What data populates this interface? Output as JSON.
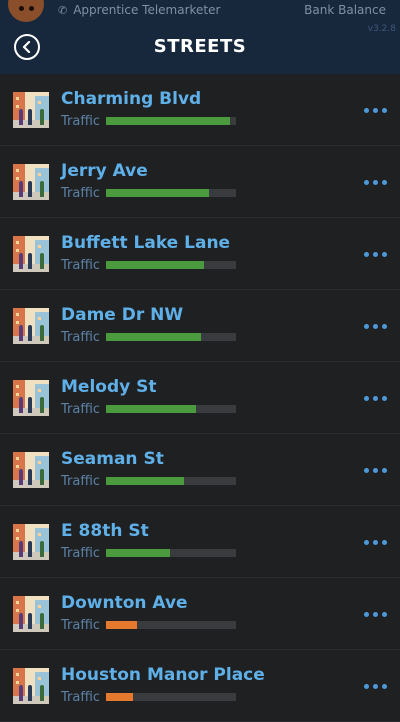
{
  "status": {
    "job_title": "Apprentice Telemarketer",
    "bank_label": "Bank Balance",
    "version": "v3.2.8"
  },
  "header": {
    "title": "STREETS"
  },
  "colors": {
    "traffic_high": "#4a9a3e",
    "traffic_low": "#e57a2e",
    "bar_bg": "#3a3b3e"
  },
  "streets": [
    {
      "name": "Charming Blvd",
      "traffic_label": "Traffic",
      "traffic_level": 0.95,
      "traffic_color": "#4a9a3e"
    },
    {
      "name": "Jerry Ave",
      "traffic_label": "Traffic",
      "traffic_level": 0.79,
      "traffic_color": "#4a9a3e"
    },
    {
      "name": "Buffett Lake Lane",
      "traffic_label": "Traffic",
      "traffic_level": 0.75,
      "traffic_color": "#4a9a3e"
    },
    {
      "name": "Dame Dr NW",
      "traffic_label": "Traffic",
      "traffic_level": 0.73,
      "traffic_color": "#4a9a3e"
    },
    {
      "name": "Melody St",
      "traffic_label": "Traffic",
      "traffic_level": 0.69,
      "traffic_color": "#4a9a3e"
    },
    {
      "name": "Seaman St",
      "traffic_label": "Traffic",
      "traffic_level": 0.6,
      "traffic_color": "#4a9a3e"
    },
    {
      "name": "E 88th St",
      "traffic_label": "Traffic",
      "traffic_level": 0.49,
      "traffic_color": "#4a9a3e"
    },
    {
      "name": "Downton Ave",
      "traffic_label": "Traffic",
      "traffic_level": 0.24,
      "traffic_color": "#e57a2e"
    },
    {
      "name": "Houston Manor Place",
      "traffic_label": "Traffic",
      "traffic_level": 0.21,
      "traffic_color": "#e57a2e"
    }
  ]
}
